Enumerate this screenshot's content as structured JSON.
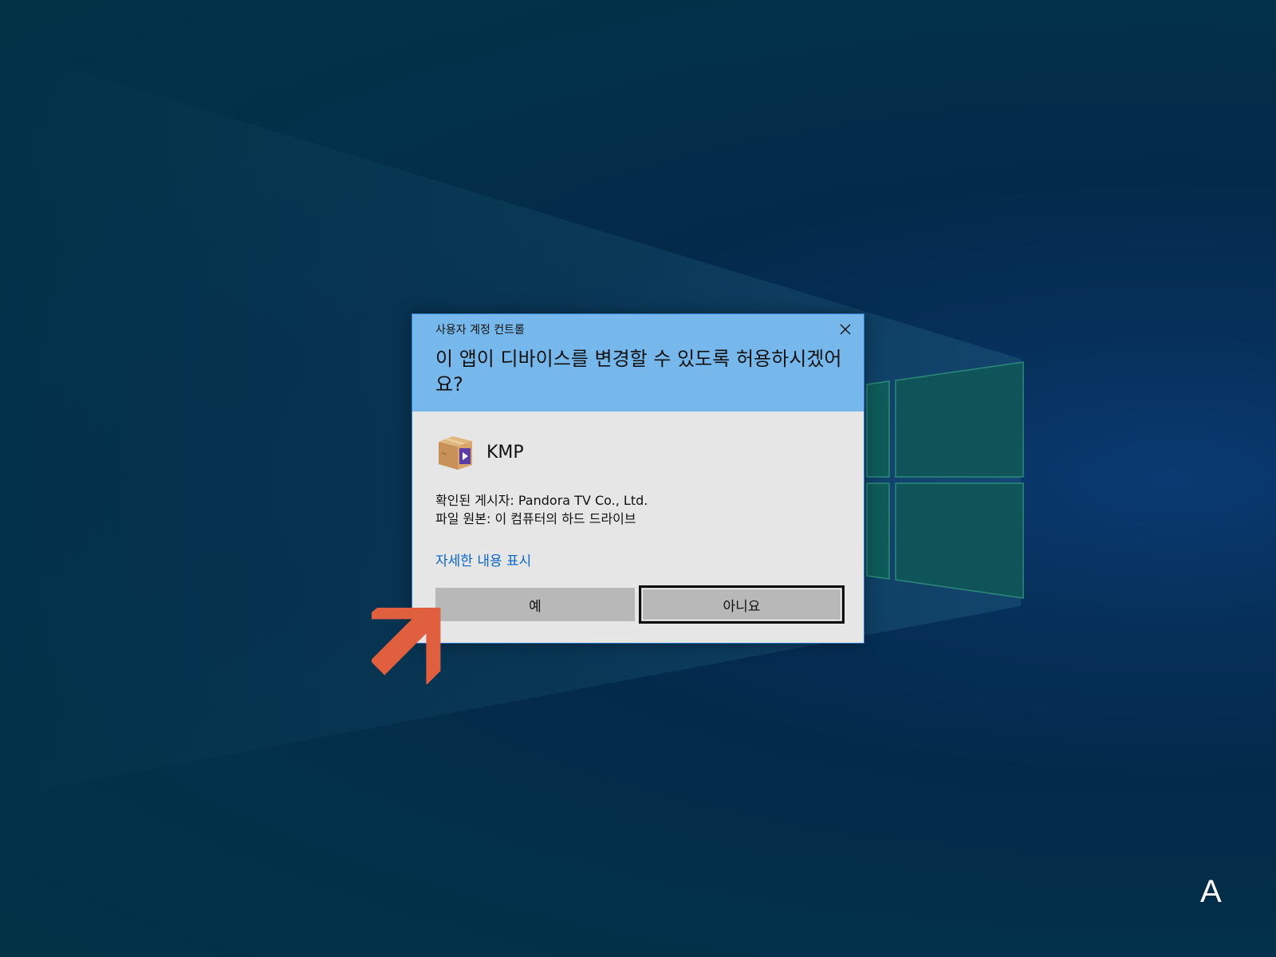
{
  "dialog": {
    "caption": "사용자 계정 컨트롤",
    "question": "이 앱이 디바이스를 변경할 수 있도록 허용하시겠어요?",
    "close_icon": "close-icon",
    "app": {
      "icon": "package-icon",
      "name": "KMP"
    },
    "publisher_line": "확인된 게시자: Pandora TV Co., Ltd.",
    "origin_line": "파일 원본: 이 컴퓨터의 하드 드라이브",
    "details_link": "자세한 내용 표시",
    "yes_label": "예",
    "no_label": "아니요"
  },
  "overlay": {
    "pointer_icon": "arrow-up-right-icon",
    "corner_label": "A"
  },
  "colors": {
    "header_bg": "#77b8ec",
    "body_bg": "#e6e6e6",
    "link": "#0a67c9",
    "button_bg": "#b8b8b8",
    "arrow": "#e05f3e",
    "desktop": "#03304a"
  }
}
